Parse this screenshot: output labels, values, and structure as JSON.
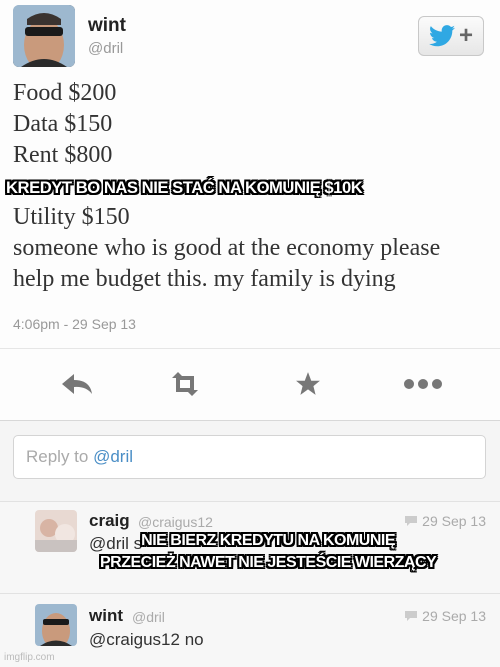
{
  "tweet": {
    "user_name": "wint",
    "user_handle": "@dril",
    "lines": [
      "Food $200",
      "Data $150",
      "Rent $800",
      "Utility $150",
      "someone who is good at the economy please",
      "help me budget this. my family is dying"
    ],
    "timestamp": "4:06pm - 29 Sep 13",
    "follow_button_icon": "twitter-bird-icon"
  },
  "reply_box": {
    "prefix": "Reply to ",
    "mention": "@dril"
  },
  "replies": [
    {
      "name": "craig",
      "handle": "@craigus12",
      "date": "29 Sep 13",
      "text": "@dril s"
    },
    {
      "name": "wint",
      "handle": "@dril",
      "date": "29 Sep 13",
      "text": "@craigus12 no"
    }
  ],
  "captions": {
    "top": "KREDYT BO NAS NIE STAĆ NA KOMUNIĘ $10K",
    "bottom_line1": "NIE BIERZ KREDYTU NA KOMUNIĘ",
    "bottom_line2": "PRZECIEŻ NAWET NIE JESTEŚCIE WIERZĄCY"
  },
  "watermark": "imgflip.com",
  "colors": {
    "twitter_blue": "#2fa8e3",
    "link_blue": "#4a8ec6"
  }
}
